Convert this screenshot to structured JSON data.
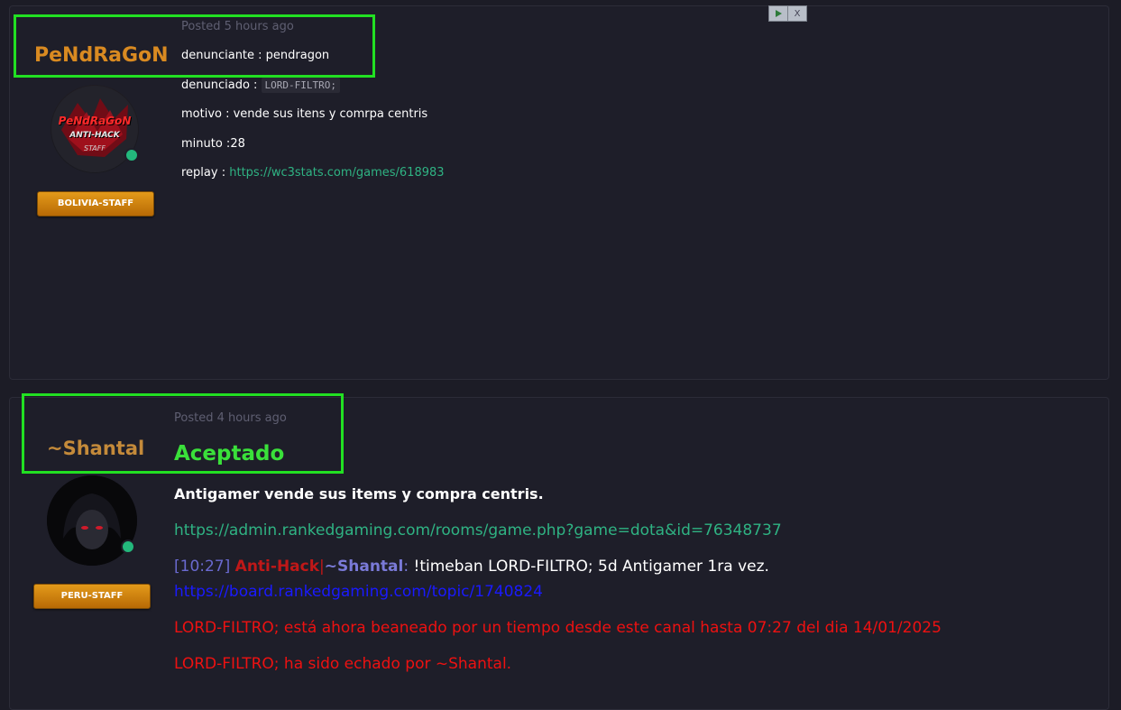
{
  "post1": {
    "username": "PeNdRaGoN",
    "posted": "Posted 5 hours ago",
    "rank": "BOLIVIA-STAFF",
    "avatar_text_top": "PeNdRaGoN",
    "avatar_text_mid": "ANTI-HACK",
    "avatar_text_bot": "STAFF",
    "lines": {
      "denunciante": "denunciante : pendragon",
      "denunciado_label": "denunciado : ",
      "denunciado_value": "LORD-FILTRO;",
      "motivo": "motivo : vende sus itens y comrpa centris",
      "minuto": "minuto :28",
      "replay_label": "replay : ",
      "replay_link": "https://wc3stats.com/games/618983"
    }
  },
  "post2": {
    "username": "~Shantal",
    "posted": "Posted 4 hours ago",
    "rank": "PERU-STAFF",
    "status": "Aceptado",
    "summary": "Antigamer vende sus items y compra centris.",
    "game_link": "https://admin.rankedgaming.com/rooms/game.php?game=dota&id=76348737",
    "chat": {
      "time": "[10:27]",
      "tag": "Anti-Hack",
      "sep": "|",
      "user": "~Shantal",
      "colon": ":",
      "command": " !timeban LORD-FILTRO; 5d Antigamer 1ra vez."
    },
    "board_link": "https://board.rankedgaming.com/topic/1740824",
    "ban_msg": "LORD-FILTRO; está ahora beaneado por un tiempo desde este canal hasta 07:27 del dia 14/01/2025",
    "kick_msg": "LORD-FILTRO; ha sido echado por ~Shantal."
  },
  "ad": {
    "play_icon": "play-icon",
    "close_label": "X"
  },
  "colors": {
    "username1": "#d98a21",
    "username2": "#c48a3a",
    "accepted": "#3ae03a",
    "link_green": "#2fb383",
    "ban_red": "#ee1111",
    "board_blue": "#1a1aff",
    "chat_time": "#6a6ad0",
    "chat_tag": "#c01818",
    "chat_user": "#7a7ad8"
  }
}
